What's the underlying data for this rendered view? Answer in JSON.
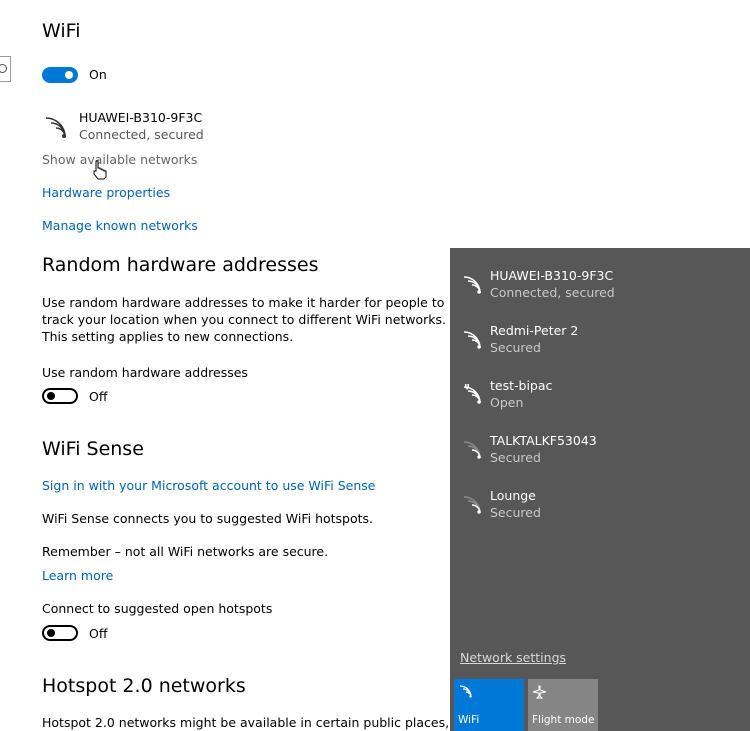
{
  "wifi": {
    "title": "WiFi",
    "toggle_state": "On",
    "connected_network": {
      "name": "HUAWEI-B310-9F3C",
      "status": "Connected, secured"
    },
    "show_available_link": "Show available networks",
    "hardware_link": "Hardware properties",
    "manage_link": "Manage known networks"
  },
  "random_hw": {
    "title": "Random hardware addresses",
    "description_lines": [
      "Use random hardware addresses to make it harder for people to",
      "track your location when you connect to different WiFi networks.",
      "This setting applies to new connections."
    ],
    "setting_label": "Use random hardware addresses",
    "toggle_state": "Off"
  },
  "wifi_sense": {
    "title": "WiFi Sense",
    "sign_in_link": "Sign in with your Microsoft account to use WiFi Sense",
    "description": "WiFi Sense connects you to suggested WiFi hotspots.",
    "remember": "Remember – not all WiFi networks are secure.",
    "learn_more": "Learn more",
    "connect_label": "Connect to suggested open hotspots",
    "toggle_state": "Off"
  },
  "hotspot": {
    "title": "Hotspot 2.0 networks",
    "description": "Hotspot 2.0 networks might be available in certain public places,"
  },
  "flyout": {
    "networks": [
      {
        "name": "HUAWEI-B310-9F3C",
        "status": "Connected, secured",
        "icon": "wifi-signal-full-icon"
      },
      {
        "name": "Redmi-Peter 2",
        "status": "Secured",
        "icon": "wifi-signal-full-icon"
      },
      {
        "name": "test-bipac",
        "status": "Open",
        "icon": "wifi-open-warning-icon"
      },
      {
        "name": "TALKTALKF53043",
        "status": "Secured",
        "icon": "wifi-signal-weak-icon"
      },
      {
        "name": "Lounge",
        "status": "Secured",
        "icon": "wifi-signal-weak-icon"
      }
    ],
    "network_settings": "Network settings",
    "tiles": {
      "wifi": "WiFi",
      "flight": "Flight mode"
    }
  },
  "colors": {
    "accent": "#0078d7",
    "link": "#0063b1",
    "flyout_bg": "#575757",
    "flight_tile": "#858585"
  }
}
